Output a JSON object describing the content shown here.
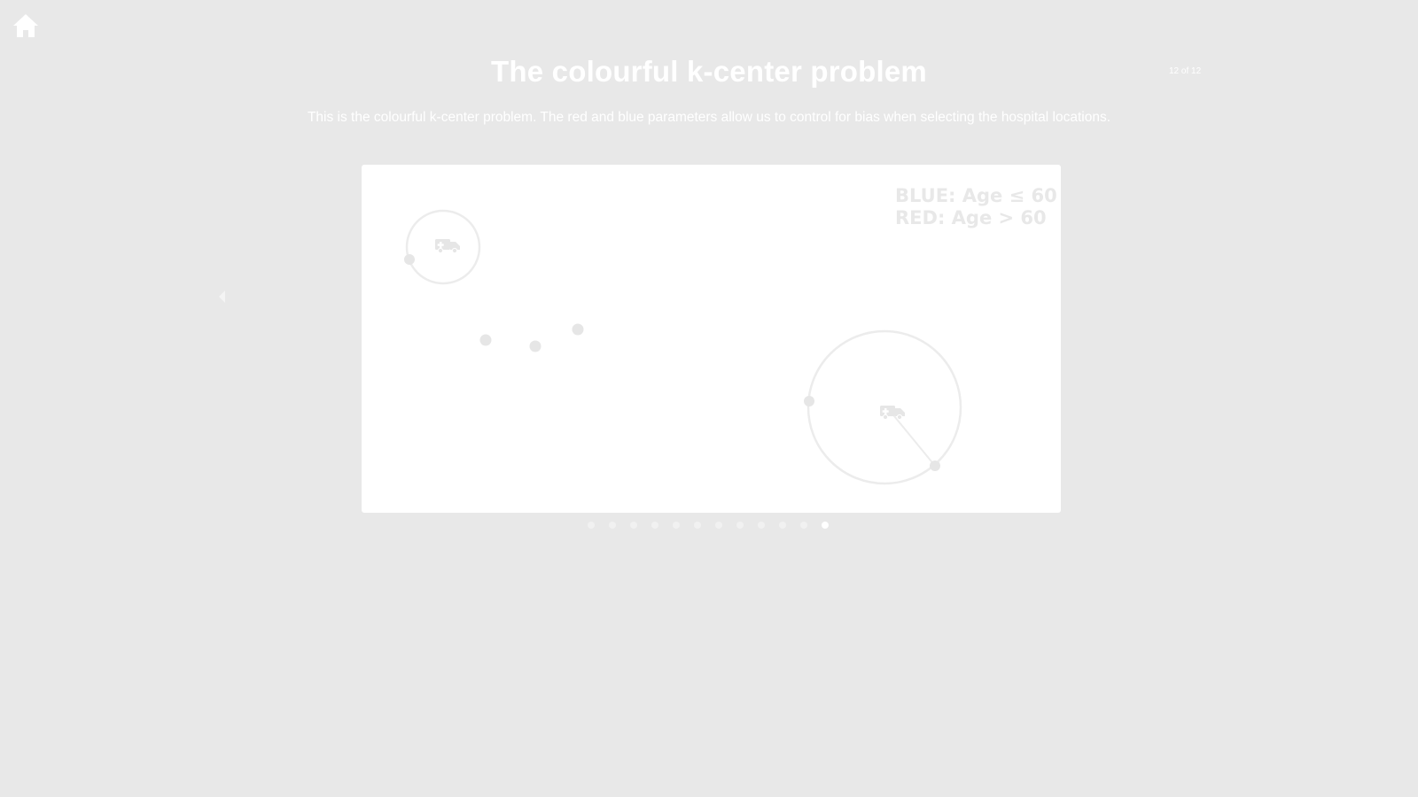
{
  "nav": {
    "home_icon": "home-icon",
    "prev_icon": "chevron-left-icon"
  },
  "header": {
    "title": "The colourful k-center problem",
    "page_counter": "12 of 12",
    "subtitle": "This is the colourful k-center problem. The red and blue parameters allow us to control for bias when selecting the hospital locations."
  },
  "slide": {
    "legend": {
      "blue": "BLUE: Age ≤ 60",
      "red": "RED: Age > 60"
    },
    "icons": [
      "ambulance-icon",
      "ambulance-icon"
    ]
  },
  "pagination": {
    "total": 12,
    "current": 12
  },
  "colors": {
    "background": "#e8e8e8",
    "text": "#ffffff",
    "faint": "#e8e8e8"
  }
}
